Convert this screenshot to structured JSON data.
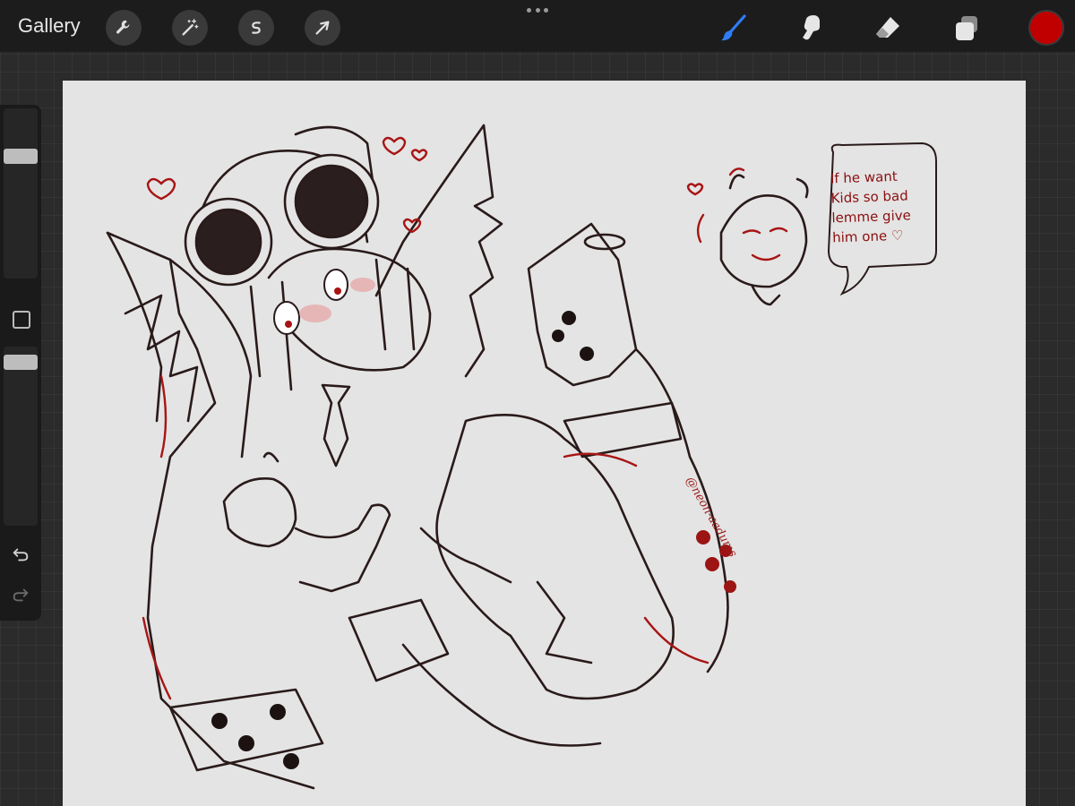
{
  "toolbar": {
    "gallery_label": "Gallery",
    "left_tools": [
      {
        "name": "actions",
        "icon": "wrench-icon"
      },
      {
        "name": "adjustments",
        "icon": "magic-wand-icon"
      },
      {
        "name": "selection",
        "icon": "selection-s-icon"
      },
      {
        "name": "transform",
        "icon": "arrow-cursor-icon"
      }
    ],
    "right_tools": [
      {
        "name": "brush",
        "icon": "brush-icon",
        "active": true
      },
      {
        "name": "smudge",
        "icon": "smudge-icon"
      },
      {
        "name": "eraser",
        "icon": "eraser-icon"
      },
      {
        "name": "layers",
        "icon": "layers-icon"
      }
    ],
    "active_color": "#c00000",
    "active_tool_color": "#2f7df6"
  },
  "sidebar": {
    "brush_size_level": 0.74,
    "opacity_level": 0.95,
    "modify_icon": "square-icon",
    "undo_icon": "undo-arrow-icon",
    "redo_icon": "redo-arrow-icon"
  },
  "canvas": {
    "background": "#e4e4e4",
    "line_color": "#2a1a1a",
    "accent_color": "#a81414",
    "speech_bubble": {
      "lines": [
        "If he want",
        "Kids so bad",
        "lemme give",
        "him one ♡"
      ]
    },
    "signature": "@neon-aadums"
  }
}
